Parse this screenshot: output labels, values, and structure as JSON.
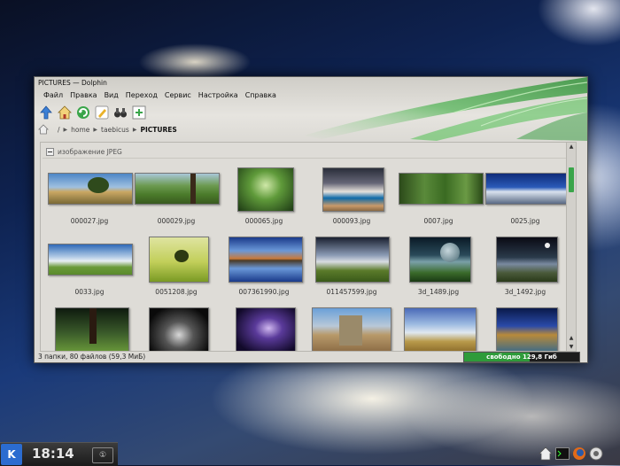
{
  "window": {
    "title": "PICTURES — Dolphin",
    "menu": [
      {
        "label": "Файл",
        "key": "menu-file"
      },
      {
        "label": "Правка",
        "key": "menu-edit"
      },
      {
        "label": "Вид",
        "key": "menu-view"
      },
      {
        "label": "Переход",
        "key": "menu-go"
      },
      {
        "label": "Сервис",
        "key": "menu-tools"
      },
      {
        "label": "Настройка",
        "key": "menu-settings"
      },
      {
        "label": "Справка",
        "key": "menu-help"
      }
    ],
    "toolbar": [
      {
        "icon": "up-arrow-icon"
      },
      {
        "icon": "home-icon"
      },
      {
        "icon": "reload-icon"
      },
      {
        "icon": "edit-icon"
      },
      {
        "icon": "binoculars-icon"
      },
      {
        "icon": "new-tab-icon"
      }
    ],
    "breadcrumb": {
      "root": "/",
      "items": [
        "home",
        "taebicus"
      ],
      "current": "PICTURES"
    }
  },
  "view": {
    "group_label": "изображение JPEG",
    "files": [
      "000027.jpg",
      "000029.jpg",
      "000065.jpg",
      "000093.jpg",
      "0007.jpg",
      "0025.jpg",
      "0033.jpg",
      "0051208.jpg",
      "007361990.jpg",
      "011457599.jpg",
      "3d_1489.jpg",
      "3d_1492.jpg"
    ]
  },
  "statusbar": {
    "text": "3 папки, 80 файлов (59,3 МиБ)",
    "free_space": "свободно 129,8 Гиб",
    "free_fraction": 0.57
  },
  "panel": {
    "clock": "18:14"
  },
  "colors": {
    "accent_green": "#2e9b3a",
    "kmenu_blue": "#2b6cd0"
  }
}
